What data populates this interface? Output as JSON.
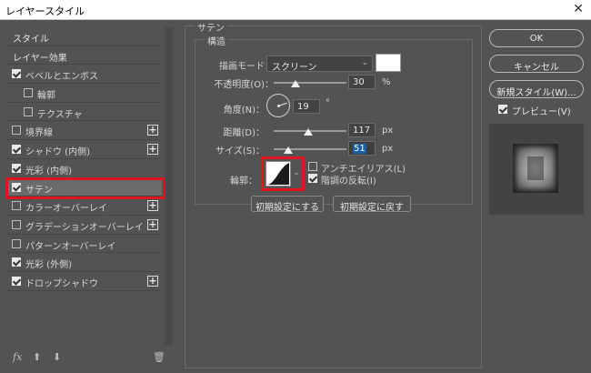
{
  "window": {
    "title": "レイヤースタイル",
    "close_glyph": "✕"
  },
  "style_list": {
    "items": [
      {
        "label": "スタイル",
        "type": "header"
      },
      {
        "label": "レイヤー効果",
        "type": "header"
      },
      {
        "label": "ベベルとエンボス",
        "checked": true,
        "plus": false
      },
      {
        "label": "輪郭",
        "checked": false,
        "sub": true
      },
      {
        "label": "テクスチャ",
        "checked": false,
        "sub": true
      },
      {
        "label": "境界線",
        "checked": false,
        "plus": true
      },
      {
        "label": "シャドウ (内側)",
        "checked": true,
        "plus": true
      },
      {
        "label": "光彩 (内側)",
        "checked": true,
        "plus": false
      },
      {
        "label": "サテン",
        "checked": true,
        "plus": false,
        "selected": true
      },
      {
        "label": "カラーオーバーレイ",
        "checked": false,
        "plus": true
      },
      {
        "label": "グラデーションオーバーレイ",
        "checked": false,
        "plus": true
      },
      {
        "label": "パターンオーバーレイ",
        "checked": false,
        "plus": false
      },
      {
        "label": "光彩 (外側)",
        "checked": true,
        "plus": false
      },
      {
        "label": "ドロップシャドウ",
        "checked": true,
        "plus": true
      }
    ],
    "footer": {
      "fx": "fx",
      "up": "⬆",
      "down": "⬇",
      "trash": "🗑"
    }
  },
  "satin": {
    "title": "サテン",
    "group_title": "構造",
    "blend_mode": {
      "label": "描画モード：",
      "value": "スクリーン",
      "color": "#ffffff"
    },
    "opacity": {
      "label": "不透明度(O)：",
      "value": "30",
      "unit": "%",
      "level": 0.3
    },
    "angle": {
      "label": "角度(N)：",
      "value": "19",
      "unit": "°"
    },
    "distance": {
      "label": "距離(D)：",
      "value": "117",
      "unit": "px",
      "level": 0.47
    },
    "size": {
      "label": "サイズ(S)：",
      "value": "51",
      "unit": "px",
      "level": 0.2
    },
    "contour": {
      "label": "輪郭："
    },
    "antialias": {
      "label": "アンチエイリアス(L)",
      "checked": false
    },
    "invert": {
      "label": "階調の反転(I)",
      "checked": true
    },
    "buttons": {
      "make_default": "初期設定にする",
      "reset_default": "初期設定に戻す"
    }
  },
  "right": {
    "ok": "OK",
    "cancel": "キャンセル",
    "new_style": "新規スタイル(W)...",
    "preview": {
      "label": "プレビュー(V)",
      "checked": true
    }
  }
}
